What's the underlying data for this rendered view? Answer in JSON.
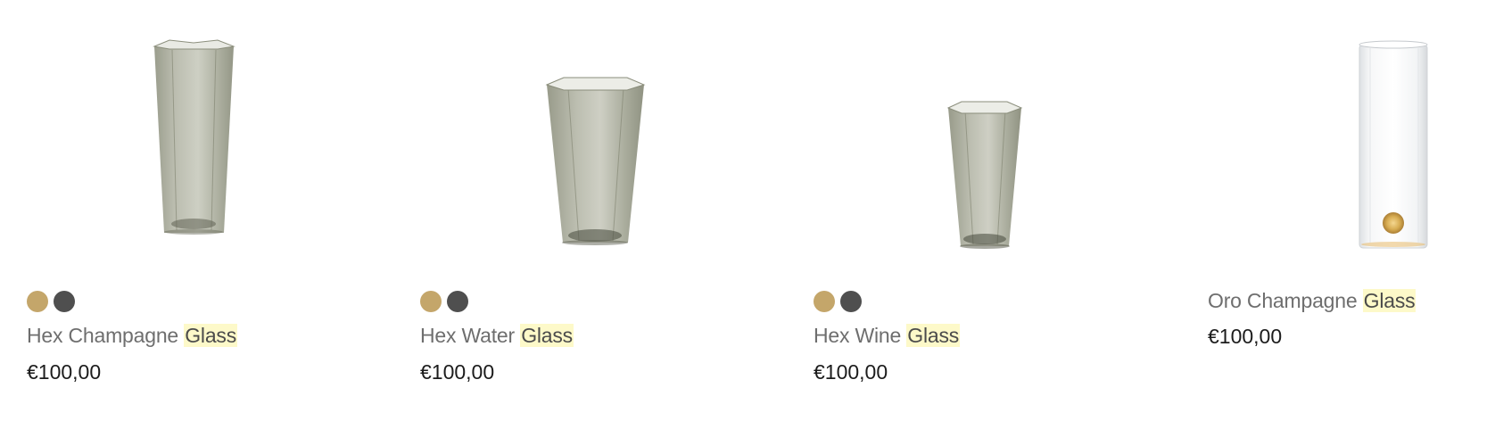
{
  "products": [
    {
      "name_main": "Hex Champagne",
      "name_highlight": "Glass",
      "price": "€100,00",
      "image_icon": "hex-champagne-glass-image",
      "swatches": [
        {
          "color": "#c4a66a",
          "name": "gold-swatch"
        },
        {
          "color": "#4f4f4f",
          "name": "smoke-swatch"
        }
      ]
    },
    {
      "name_main": "Hex Water",
      "name_highlight": "Glass",
      "price": "€100,00",
      "image_icon": "hex-water-glass-image",
      "swatches": [
        {
          "color": "#c4a66a",
          "name": "gold-swatch"
        },
        {
          "color": "#4f4f4f",
          "name": "smoke-swatch"
        }
      ]
    },
    {
      "name_main": "Hex Wine",
      "name_highlight": "Glass",
      "price": "€100,00",
      "image_icon": "hex-wine-glass-image",
      "swatches": [
        {
          "color": "#c4a66a",
          "name": "gold-swatch"
        },
        {
          "color": "#4f4f4f",
          "name": "smoke-swatch"
        }
      ]
    },
    {
      "name_main": "Oro Champagne",
      "name_highlight": "Glass",
      "price": "€100,00",
      "image_icon": "oro-champagne-glass-image",
      "swatches": []
    }
  ],
  "colors": {
    "highlight": "#fdf9c9",
    "smoke_glass": "#9a9d8a",
    "clear_glass": "#e6e9ec",
    "gold": "#c4a66a"
  }
}
